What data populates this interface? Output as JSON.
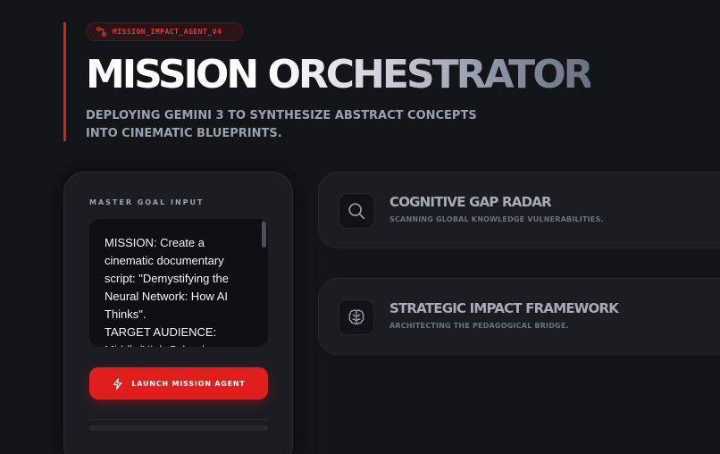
{
  "header": {
    "badge_label": "MISSION_IMPACT_AGENT_V4",
    "badge_icon": "agent-network-icon",
    "title_word1": "MISSION",
    "title_word2": "ORCHESTRATOR",
    "subtitle": "DEPLOYING GEMINI 3 TO SYNTHESIZE ABSTRACT CONCEPTS INTO CINEMATIC BLUEPRINTS."
  },
  "goal_input": {
    "heading": "MASTER GOAL INPUT",
    "value": "MISSION: Create a cinematic documentary script: \"Demystifying the Neural Network: How AI Thinks\".\nTARGET AUDIENCE: Middle/High School",
    "launch_label": "LAUNCH MISSION AGENT",
    "launch_icon": "lightning-icon"
  },
  "features": [
    {
      "title": "COGNITIVE GAP RADAR",
      "subtitle": "SCANNING GLOBAL KNOWLEDGE VULNERABILITIES.",
      "icon": "search-icon"
    },
    {
      "title": "STRATEGIC IMPACT FRAMEWORK",
      "subtitle": "ARCHITECTING THE PEDAGOGICAL BRIDGE.",
      "icon": "brain-icon"
    }
  ],
  "colors": {
    "background": "#141519",
    "accent": "#e01e1e",
    "card": "#1c1d22"
  }
}
